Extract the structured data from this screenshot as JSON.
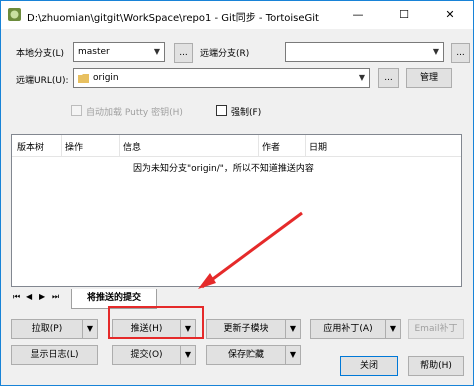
{
  "window": {
    "title": "D:\\zhuomian\\gitgit\\WorkSpace\\repo1 - Git同步 - TortoiseGit",
    "min_glyph": "—",
    "max_glyph": "☐",
    "close_glyph": "✕"
  },
  "local_branch": {
    "label": "本地分支(L)",
    "value": "master",
    "more": "..."
  },
  "remote_branch": {
    "label": "远端分支(R)",
    "value": "",
    "more": "..."
  },
  "remote_url": {
    "label": "远端URL(U):",
    "value": "origin",
    "manage": "管理"
  },
  "options": {
    "autoload_putty": "自动加载 Putty 密钥(H)",
    "force": "强制(F)"
  },
  "list": {
    "columns": [
      "版本树",
      "操作",
      "信息",
      "作者",
      "日期"
    ],
    "message": "因为未知分支\"origin/\"，所以不知道推送内容"
  },
  "tabs": {
    "nav": [
      "⏮",
      "◀",
      "▶",
      "⏭"
    ],
    "active": "将推送的提交"
  },
  "buttons": {
    "pull": "拉取(P)",
    "push": "推送(H)",
    "update_submodule": "更新子模块",
    "apply_patch": "应用补丁(A)",
    "email_patch": "Email补丁",
    "show_log": "显示日志(L)",
    "commit": "提交(O)",
    "stash": "保存贮藏",
    "close": "关闭",
    "help": "帮助(H)"
  },
  "colors": {
    "accent_border": "#1883d7",
    "annotation": "#e52a2a"
  }
}
